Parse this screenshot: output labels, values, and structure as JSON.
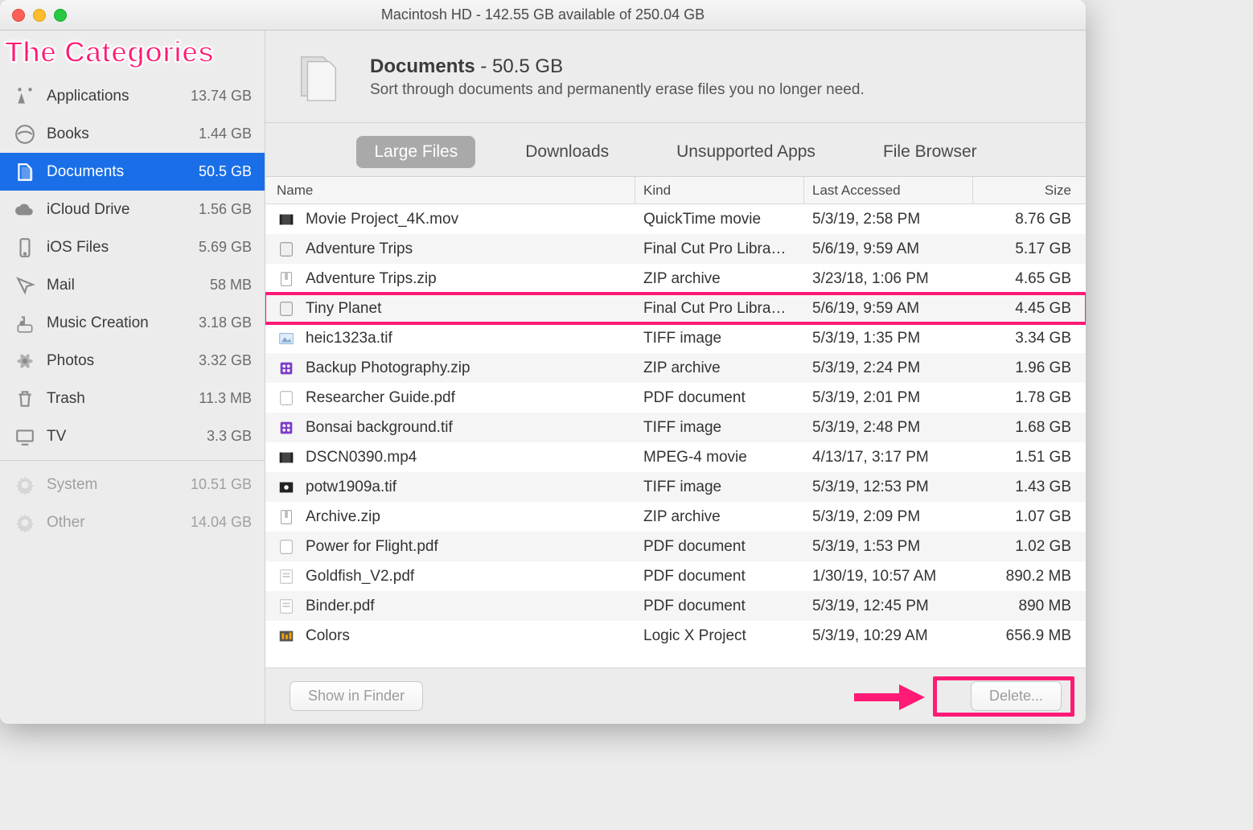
{
  "window": {
    "title": "Macintosh HD - 142.55 GB available of 250.04 GB"
  },
  "annotation": {
    "categories_label": "The Categories"
  },
  "sidebar": {
    "items": [
      {
        "label": "Applications",
        "size": "13.74 GB",
        "icon": "apps"
      },
      {
        "label": "Books",
        "size": "1.44 GB",
        "icon": "books"
      },
      {
        "label": "Documents",
        "size": "50.5 GB",
        "icon": "documents",
        "selected": true
      },
      {
        "label": "iCloud Drive",
        "size": "1.56 GB",
        "icon": "cloud"
      },
      {
        "label": "iOS Files",
        "size": "5.69 GB",
        "icon": "phone"
      },
      {
        "label": "Mail",
        "size": "58 MB",
        "icon": "mail"
      },
      {
        "label": "Music Creation",
        "size": "3.18 GB",
        "icon": "music"
      },
      {
        "label": "Photos",
        "size": "3.32 GB",
        "icon": "photos"
      },
      {
        "label": "Trash",
        "size": "11.3 MB",
        "icon": "trash"
      },
      {
        "label": "TV",
        "size": "3.3 GB",
        "icon": "tv"
      }
    ],
    "lower": [
      {
        "label": "System",
        "size": "10.51 GB",
        "icon": "gear"
      },
      {
        "label": "Other",
        "size": "14.04 GB",
        "icon": "gear"
      }
    ]
  },
  "header": {
    "title_strong": "Documents",
    "title_rest": " - 50.5 GB",
    "subtitle": "Sort through documents and permanently erase files you no longer need."
  },
  "tabs": [
    {
      "label": "Large Files",
      "active": true
    },
    {
      "label": "Downloads"
    },
    {
      "label": "Unsupported Apps"
    },
    {
      "label": "File Browser"
    }
  ],
  "table": {
    "columns": {
      "name": "Name",
      "kind": "Kind",
      "date": "Last Accessed",
      "size": "Size"
    },
    "rows": [
      {
        "name": "Movie Project_4K.mov",
        "kind": "QuickTime movie",
        "date": "5/3/19, 2:58 PM",
        "size": "8.76 GB",
        "icon": "mov"
      },
      {
        "name": "Adventure Trips",
        "kind": "Final Cut Pro Libra…",
        "date": "5/6/19, 9:59 AM",
        "size": "5.17 GB",
        "icon": "fcp"
      },
      {
        "name": "Adventure Trips.zip",
        "kind": "ZIP archive",
        "date": "3/23/18, 1:06 PM",
        "size": "4.65 GB",
        "icon": "zip"
      },
      {
        "name": "Tiny Planet",
        "kind": "Final Cut Pro Libra…",
        "date": "5/6/19, 9:59 AM",
        "size": "4.45 GB",
        "icon": "fcp",
        "highlighted": true
      },
      {
        "name": "heic1323a.tif",
        "kind": "TIFF image",
        "date": "5/3/19, 1:35 PM",
        "size": "3.34 GB",
        "icon": "img"
      },
      {
        "name": "Backup Photography.zip",
        "kind": "ZIP archive",
        "date": "5/3/19, 2:24 PM",
        "size": "1.96 GB",
        "icon": "zip-purple"
      },
      {
        "name": "Researcher Guide.pdf",
        "kind": "PDF document",
        "date": "5/3/19, 2:01 PM",
        "size": "1.78 GB",
        "icon": "pdf"
      },
      {
        "name": "Bonsai background.tif",
        "kind": "TIFF image",
        "date": "5/3/19, 2:48 PM",
        "size": "1.68 GB",
        "icon": "img-purple"
      },
      {
        "name": "DSCN0390.mp4",
        "kind": "MPEG-4 movie",
        "date": "4/13/17, 3:17 PM",
        "size": "1.51 GB",
        "icon": "mov"
      },
      {
        "name": "potw1909a.tif",
        "kind": "TIFF image",
        "date": "5/3/19, 12:53 PM",
        "size": "1.43 GB",
        "icon": "img-dark"
      },
      {
        "name": "Archive.zip",
        "kind": "ZIP archive",
        "date": "5/3/19, 2:09 PM",
        "size": "1.07 GB",
        "icon": "zip"
      },
      {
        "name": "Power for Flight.pdf",
        "kind": "PDF document",
        "date": "5/3/19, 1:53 PM",
        "size": "1.02 GB",
        "icon": "pdf"
      },
      {
        "name": "Goldfish_V2.pdf",
        "kind": "PDF document",
        "date": "1/30/19, 10:57 AM",
        "size": "890.2 MB",
        "icon": "pdf-light"
      },
      {
        "name": "Binder.pdf",
        "kind": "PDF document",
        "date": "5/3/19, 12:45 PM",
        "size": "890 MB",
        "icon": "pdf-light"
      },
      {
        "name": "Colors",
        "kind": "Logic X Project",
        "date": "5/3/19, 10:29 AM",
        "size": "656.9 MB",
        "icon": "logic"
      }
    ]
  },
  "footer": {
    "show_in_finder": "Show in Finder",
    "delete": "Delete..."
  }
}
